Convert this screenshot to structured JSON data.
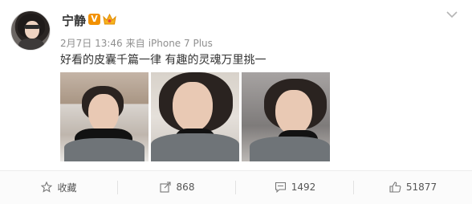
{
  "post": {
    "username": "宁静",
    "vip_badge": "V",
    "date": "2月7日 13:46",
    "source_prefix": "来自",
    "device": "iPhone 7 Plus",
    "content": "好看的皮囊千篇一律  有趣的灵魂万里挑一"
  },
  "actions": {
    "favorite": "收藏",
    "repost": "868",
    "comment": "1492",
    "like": "51877"
  },
  "colors": {
    "badge": "#f29100",
    "meta": "#8f8f8f",
    "text": "#333333"
  }
}
